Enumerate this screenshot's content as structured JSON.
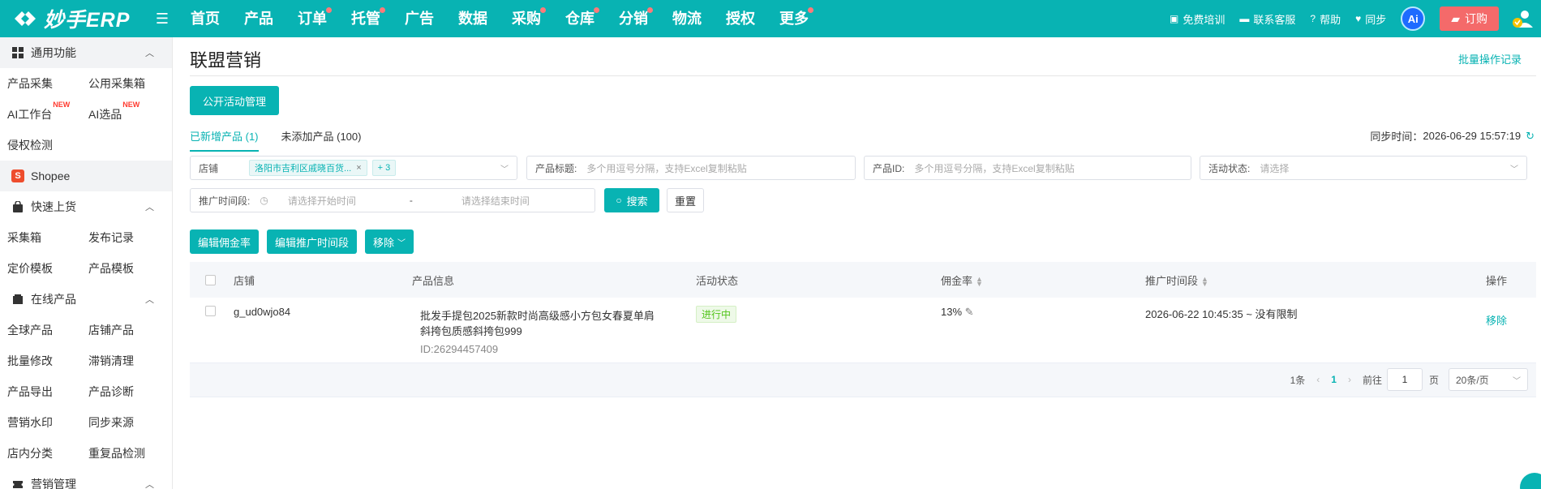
{
  "brand": {
    "name": "妙手ERP",
    "color": "#08b3b3"
  },
  "nav": [
    {
      "label": "首页",
      "dot": false
    },
    {
      "label": "产品",
      "dot": false
    },
    {
      "label": "订单",
      "dot": true
    },
    {
      "label": "托管",
      "dot": true
    },
    {
      "label": "广告",
      "dot": false
    },
    {
      "label": "数据",
      "dot": false
    },
    {
      "label": "采购",
      "dot": true
    },
    {
      "label": "仓库",
      "dot": true
    },
    {
      "label": "分销",
      "dot": true
    },
    {
      "label": "物流",
      "dot": false
    },
    {
      "label": "授权",
      "dot": false
    },
    {
      "label": "更多",
      "dot": true
    }
  ],
  "topRight": {
    "training": "免费培训",
    "support": "联系客服",
    "help": "帮助",
    "sync": "同步",
    "ai": "Ai",
    "order": "订购"
  },
  "sidebar": {
    "general": {
      "title": "通用功能",
      "items": [
        "产品采集",
        "公用采集箱",
        "AI工作台",
        "AI选品",
        "侵权检测"
      ],
      "newBadge": "NEW"
    },
    "shopee": "Shopee",
    "quick": {
      "title": "快速上货",
      "items": [
        "采集箱",
        "发布记录",
        "定价模板",
        "产品模板"
      ]
    },
    "online": {
      "title": "在线产品",
      "items": [
        "全球产品",
        "店铺产品",
        "批量修改",
        "滞销清理",
        "产品导出",
        "产品诊断",
        "营销水印",
        "同步来源",
        "店内分类",
        "重复品检测"
      ]
    },
    "marketing": {
      "title": "营销管理"
    }
  },
  "page": {
    "title": "联盟营销",
    "batchLog": "批量操作记录",
    "openActivityBtn": "公开活动管理",
    "tabs": [
      {
        "label": "已新增产品 (1)",
        "active": true
      },
      {
        "label": "未添加产品 (100)",
        "active": false
      }
    ],
    "syncLabel": "同步时间：",
    "syncTime": "2026-06-29 15:57:19"
  },
  "filters": {
    "shopLabel": "店铺",
    "shopTag": "洛阳市吉利区戚晓百货...",
    "shopMore": "+ 3",
    "titleLabel": "产品标题:",
    "titlePlaceholder": "多个用逗号分隔，支持Excel复制粘贴",
    "idLabel": "产品ID:",
    "idPlaceholder": "多个用逗号分隔，支持Excel复制粘贴",
    "statusLabel": "活动状态:",
    "statusPlaceholder": "请选择",
    "periodLabel": "推广时间段:",
    "startPlaceholder": "请选择开始时间",
    "separator": "-",
    "endPlaceholder": "请选择结束时间",
    "searchBtn": "搜索",
    "resetBtn": "重置"
  },
  "actions": {
    "editCommission": "编辑佣金率",
    "editPeriod": "编辑推广时间段",
    "remove": "移除"
  },
  "table": {
    "headers": {
      "shop": "店铺",
      "product": "产品信息",
      "status": "活动状态",
      "commission": "佣金率",
      "period": "推广时间段",
      "ops": "操作"
    },
    "rows": [
      {
        "shop": "g_ud0wjo84",
        "titleLine1": "批发手提包2025新款时尚高级感小方包女春夏单肩",
        "titleLine2": "斜挎包质感斜挎包999",
        "productId": "ID:26294457409",
        "status": "进行中",
        "commission": "13%",
        "period": "2026-06-22 10:45:35 ~ 没有限制",
        "op": "移除"
      }
    ]
  },
  "pagination": {
    "total": "1条",
    "current": "1",
    "goto": "前往",
    "gotoValue": "1",
    "pageUnit": "页",
    "pageSize": "20条/页"
  }
}
